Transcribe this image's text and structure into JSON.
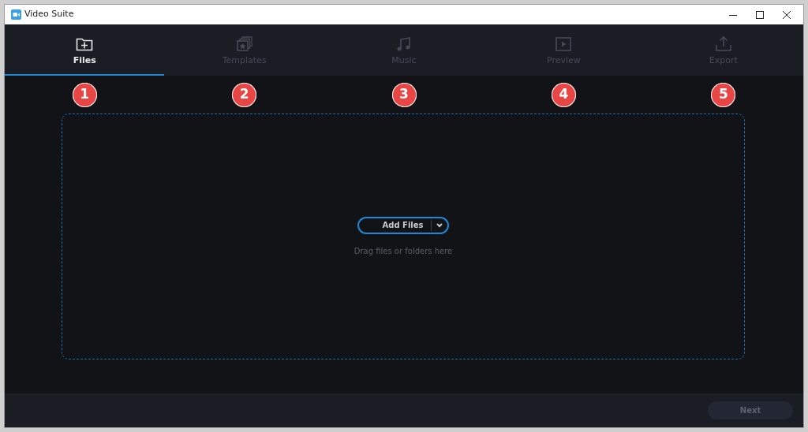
{
  "window": {
    "title": "Video Suite"
  },
  "tabs": [
    {
      "label": "Files",
      "kind": "files",
      "selected": true
    },
    {
      "label": "Templates",
      "kind": "templates",
      "selected": false
    },
    {
      "label": "Music",
      "kind": "music",
      "selected": false
    },
    {
      "label": "Preview",
      "kind": "preview",
      "selected": false
    },
    {
      "label": "Export",
      "kind": "export",
      "selected": false
    }
  ],
  "step_badges": [
    "1",
    "2",
    "3",
    "4",
    "5"
  ],
  "drop_zone": {
    "button": "Add Files",
    "hint": "Drag files or folders here"
  },
  "footer": {
    "next_button": {
      "label": "Next",
      "disabled": true
    }
  }
}
